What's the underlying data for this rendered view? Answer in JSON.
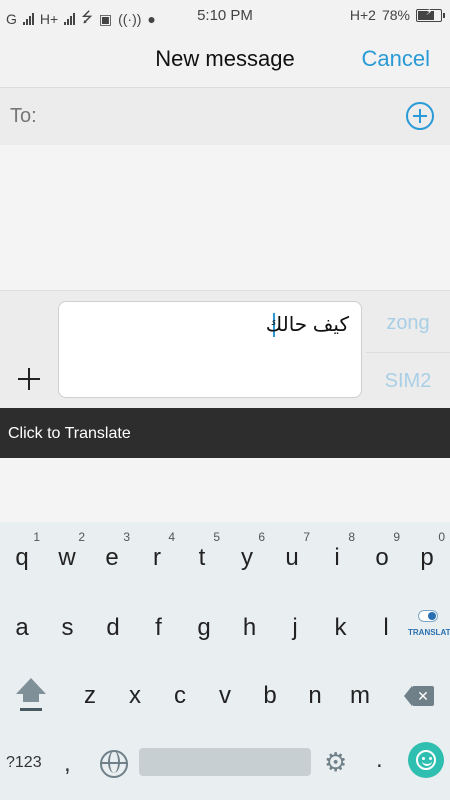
{
  "status_bar": {
    "carrier1": "G",
    "carrier2": "H+",
    "time": "5:10 PM",
    "network_right": "H+2",
    "battery_percent": "78%",
    "battery_level": 0.78
  },
  "header": {
    "title": "New message",
    "cancel_label": "Cancel"
  },
  "recipient": {
    "label": "To:"
  },
  "compose": {
    "message_text": "كيف حالك",
    "sim1_label": "zong",
    "sim2_label": "SIM2"
  },
  "translate_bar": {
    "label": "Click to Translate"
  },
  "keyboard": {
    "row1": [
      {
        "letter": "q",
        "hint": "1"
      },
      {
        "letter": "w",
        "hint": "2"
      },
      {
        "letter": "e",
        "hint": "3"
      },
      {
        "letter": "r",
        "hint": "4"
      },
      {
        "letter": "t",
        "hint": "5"
      },
      {
        "letter": "y",
        "hint": "6"
      },
      {
        "letter": "u",
        "hint": "7"
      },
      {
        "letter": "i",
        "hint": "8"
      },
      {
        "letter": "o",
        "hint": "9"
      },
      {
        "letter": "p",
        "hint": "0"
      }
    ],
    "row2": [
      "a",
      "s",
      "d",
      "f",
      "g",
      "h",
      "j",
      "k",
      "l"
    ],
    "row3": [
      "z",
      "x",
      "c",
      "v",
      "b",
      "n",
      "m"
    ],
    "translate_key_label": "TRANSLATE",
    "symbols_label": "?123",
    "comma_label": ",",
    "period_label": ".",
    "icons": [
      "shift-icon",
      "backspace-icon",
      "globe-icon",
      "gear-icon",
      "emoji-icon"
    ]
  },
  "colors": {
    "accent": "#2a9ad6",
    "sim_label": "#a9cfe6",
    "translate_bar_bg": "#2d2d2d",
    "keyboard_bg": "#e9eef1",
    "emoji_key": "#2fbfb0"
  }
}
